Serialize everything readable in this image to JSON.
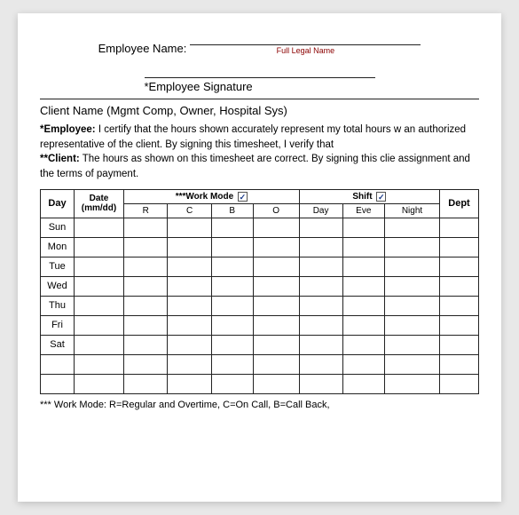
{
  "header": {
    "employee_name_label": "Employee Name:",
    "full_legal_name": "Full Legal Name",
    "signature_label": "*Employee Signature",
    "client_name": "Client Name (Mgmt Comp, Owner, Hospital Sys)"
  },
  "certify": {
    "employee_text": "*Employee:  I certify that the hours shown accurately represent my total hours w an authorized representative of the client. By signing this timesheet, I verify that",
    "client_text": "**Client:  The hours as shown on this timesheet are correct.  By signing this clie assignment and the terms of payment."
  },
  "table": {
    "col_day": "Day",
    "col_date": "Date\n(mm/dd)",
    "col_work_mode": "***Work Mode",
    "col_shift": "Shift",
    "col_dept": "Dept",
    "work_mode_sub": [
      "R",
      "C",
      "B",
      "O"
    ],
    "shift_sub": [
      "Day",
      "Eve",
      "Night"
    ],
    "rows": [
      {
        "day": "Sun"
      },
      {
        "day": "Mon"
      },
      {
        "day": "Tue"
      },
      {
        "day": "Wed"
      },
      {
        "day": "Thu"
      },
      {
        "day": "Fri"
      },
      {
        "day": "Sat"
      },
      {
        "day": ""
      },
      {
        "day": ""
      }
    ]
  },
  "footer": {
    "note": "*** Work Mode: R=Regular and Overtime, C=On Call, B=Call Back,"
  }
}
